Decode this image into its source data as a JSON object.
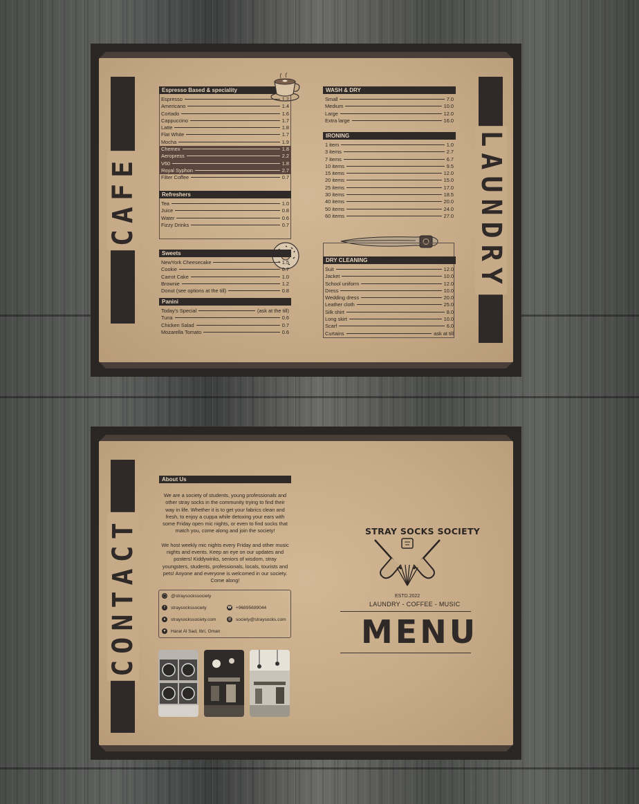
{
  "cafe_page": {
    "side_title": "CAFE",
    "espresso": {
      "title": "Espresso Based & speciality",
      "items": [
        {
          "name": "Espresso",
          "price": "1.2",
          "hl": false
        },
        {
          "name": "Americano",
          "price": "1.4",
          "hl": false
        },
        {
          "name": "Cortado",
          "price": "1.6",
          "hl": false
        },
        {
          "name": "Cappuccino",
          "price": "1.7",
          "hl": false
        },
        {
          "name": "Latte",
          "price": "1.8",
          "hl": false
        },
        {
          "name": "Flat White",
          "price": "1.7",
          "hl": false
        },
        {
          "name": "Mocha",
          "price": "1.9",
          "hl": false
        },
        {
          "name": "Chemex",
          "price": "1.8",
          "hl": true
        },
        {
          "name": "Aeropress",
          "price": "2.2",
          "hl": true
        },
        {
          "name": "V60",
          "price": "1.8",
          "hl": true
        },
        {
          "name": "Royal Syphon",
          "price": "2.7",
          "hl": true
        },
        {
          "name": "Filter Coffee",
          "price": "0.7",
          "hl": false
        }
      ]
    },
    "refreshers": {
      "title": "Refreshers",
      "items": [
        {
          "name": "Tea",
          "price": "1.0"
        },
        {
          "name": "Juice",
          "price": "0.8"
        },
        {
          "name": "Water",
          "price": "0.6"
        },
        {
          "name": "Fizzy Drinks",
          "price": "0.7"
        }
      ]
    },
    "sweets": {
      "title": "Sweets",
      "items": [
        {
          "name": "NewYork Cheesecake",
          "price": "1.5"
        },
        {
          "name": "Cookie",
          "price": "0.7"
        },
        {
          "name": "Carrot Cake",
          "price": "1.0"
        },
        {
          "name": "Brownie",
          "price": "1.2"
        },
        {
          "name": "Donut (see options at the till)",
          "price": "0.8"
        }
      ]
    },
    "panini": {
      "title": "Panini",
      "items": [
        {
          "name": "Today's Special",
          "price": "(ask at the till)"
        },
        {
          "name": "Tuna",
          "price": "0.6"
        },
        {
          "name": "Chicken Salad",
          "price": "0.7"
        },
        {
          "name": "Mozarella Tomato",
          "price": "0.6"
        }
      ]
    }
  },
  "laundry_page": {
    "side_title": "LAUNDRY",
    "wash_dry": {
      "title": "WASH & DRY",
      "items": [
        {
          "name": "Small",
          "price": "7.0"
        },
        {
          "name": "Medium",
          "price": "10.0"
        },
        {
          "name": "Large",
          "price": "12.0"
        },
        {
          "name": "Extra large",
          "price": "16.0"
        }
      ]
    },
    "ironing": {
      "title": "IRONING",
      "items": [
        {
          "name": "1 item",
          "price": "1.0"
        },
        {
          "name": "3 items",
          "price": "2.7"
        },
        {
          "name": "7 items",
          "price": "6.7"
        },
        {
          "name": "10 items",
          "price": "9.5"
        },
        {
          "name": "15 items",
          "price": "12.0"
        },
        {
          "name": "20 items",
          "price": "15.0"
        },
        {
          "name": "25 items",
          "price": "17.0"
        },
        {
          "name": "30 items",
          "price": "18.5"
        },
        {
          "name": "40 items",
          "price": "20.0"
        },
        {
          "name": "50 items",
          "price": "24.0"
        },
        {
          "name": "60 items",
          "price": "27.0"
        }
      ]
    },
    "dry_cleaning": {
      "title": "DRY CLEANING",
      "items": [
        {
          "name": "Suit",
          "price": "12.0"
        },
        {
          "name": "Jacket",
          "price": "10.0"
        },
        {
          "name": "School uniform",
          "price": "12.0"
        },
        {
          "name": "Dress",
          "price": "10.0"
        },
        {
          "name": "Wedding dress",
          "price": "20.0"
        },
        {
          "name": "Leather cloth",
          "price": "25.0"
        },
        {
          "name": "Silk shirt",
          "price": "8.0"
        },
        {
          "name": "Long skirt",
          "price": "10.0"
        },
        {
          "name": "Scarf",
          "price": "6.0"
        },
        {
          "name": "Curtains",
          "price": "ask at till"
        }
      ]
    }
  },
  "contact_page": {
    "side_title": "CONTACT",
    "about_title": "About Us",
    "about_p1": "We are a society of students, young professionals and other stray socks in the community trying to find their way in life. Whether it is to get your fabrics clean and fresh, to enjoy a cuppa while detoxing your ears with some Friday open mic nights, or even to find socks that match you, come along and join the society!",
    "about_p2": "We host weekly mic nights every Friday and other music nights and events. Keep an eye on our updates and posters! Kiddywinks, seniors of wisdom, stray youngsters, students, professionals, locals, tourists and pets! Anyone and everyone is welcomed in our society. Come along!",
    "instagram": "@straysockssociety",
    "facebook": "straysockssociety",
    "phone": "+96895699044",
    "website": "straysockssociety.com",
    "email": "society@straysocks.com",
    "address": "Harat Al Sad, Ibri, Oman"
  },
  "cover_page": {
    "brand": "STRAY SOCKS SOCIETY",
    "established": "ESTD.2022",
    "tagline": "LAUNDRY - COFFEE - MUSIC",
    "menu_word": "MENU"
  },
  "colors": {
    "paper": "#c7ab88",
    "dark": "#2f2927",
    "highlight": "#5b463d",
    "wood": "#555755"
  }
}
